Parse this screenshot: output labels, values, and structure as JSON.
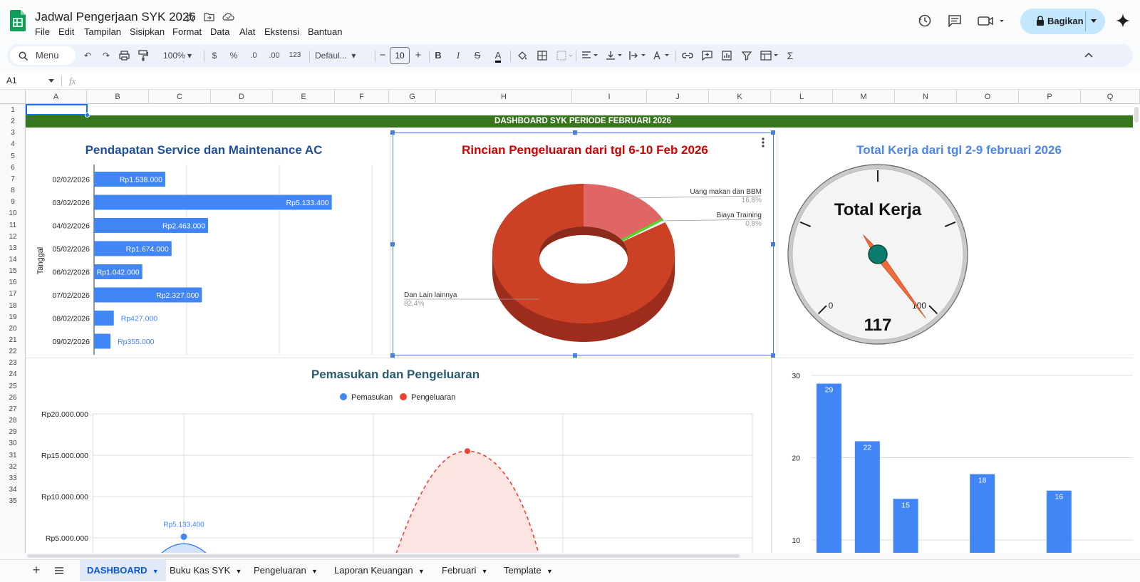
{
  "app": {
    "doc_title": "Jadwal Pengerjaan SYK 2026",
    "menu": [
      "File",
      "Edit",
      "Tampilan",
      "Sisipkan",
      "Format",
      "Data",
      "Alat",
      "Ekstensi",
      "Bantuan"
    ],
    "share_label": "Bagikan",
    "brand_color": "#0f9d58"
  },
  "toolbar": {
    "search_label": "Menu",
    "zoom": "100%",
    "currency": "$",
    "percent": "%",
    "dec_decrease": ".0",
    "dec_increase": ".00",
    "number_format": "123",
    "font": "Defaul...",
    "font_size": "10",
    "bold": "B",
    "italic": "I",
    "strike": "S",
    "text_color": "A"
  },
  "formula_bar": {
    "cell_ref": "A1",
    "fx": "fx",
    "value": ""
  },
  "columns": [
    "A",
    "B",
    "C",
    "D",
    "E",
    "F",
    "G",
    "H",
    "I",
    "J",
    "K",
    "L",
    "M",
    "N",
    "O",
    "P",
    "Q"
  ],
  "rows": [
    "1",
    "2",
    "3",
    "4",
    "5",
    "6",
    "7",
    "8",
    "9",
    "10",
    "11",
    "12",
    "13",
    "14",
    "15",
    "16",
    "17",
    "18",
    "19",
    "20",
    "21",
    "22",
    "23",
    "24",
    "25",
    "26",
    "27",
    "28",
    "29",
    "30",
    "31",
    "32",
    "33",
    "34",
    "35"
  ],
  "banner": {
    "text": "DASHBOARD SYK PERIODE FEBRUARI 2026",
    "color": "#38761d"
  },
  "chart_data": [
    {
      "type": "bar",
      "orientation": "horizontal",
      "title": "Pendapatan Service dan Maintenance AC",
      "ylabel": "Tanggal",
      "categories": [
        "02/02/2026",
        "03/02/2026",
        "04/02/2026",
        "05/02/2026",
        "06/02/2026",
        "07/02/2026",
        "08/02/2026",
        "09/02/2026"
      ],
      "values": [
        1538000,
        5133400,
        2463000,
        1674000,
        1042000,
        2327000,
        427000,
        355000
      ],
      "data_labels": [
        "Rp1.538.000",
        "Rp5.133.400",
        "Rp2.463.000",
        "Rp1.674.000",
        "Rp1.042.000",
        "Rp2.327.000",
        "Rp427.000",
        "Rp355.000"
      ],
      "color": "#4285f4"
    },
    {
      "type": "pie",
      "style": "3d-donut",
      "title": "Rincian Pengeluaran dari tgl 6-10 Feb 2026",
      "slices": [
        {
          "label": "Uang makan dan BBM",
          "pct_label": "16,8%",
          "value": 16.8,
          "color": "#e06666"
        },
        {
          "label": "Biaya Training",
          "pct_label": "0,8%",
          "value": 0.8,
          "color": "#54d42a"
        },
        {
          "label": "Dan Lain lainnya",
          "pct_label": "82,4%",
          "value": 82.4,
          "color": "#cc4125"
        }
      ]
    },
    {
      "type": "gauge",
      "title": "Total Kerja dari tgl 2-9 februari 2026",
      "gauge_label": "Total Kerja",
      "value": 117,
      "value_label": "117",
      "min_label": "0",
      "max_label": "100",
      "min": 0,
      "max": 100
    },
    {
      "type": "area",
      "title": "Pemasukan dan Pengeluaran",
      "series": [
        {
          "name": "Pemasukan",
          "color": "#4285f4",
          "peak": 5133400,
          "peak_label": "Rp5.133.400"
        },
        {
          "name": "Pengeluaran",
          "color": "#ea4335",
          "peak": 15500000
        }
      ],
      "ytick_labels": [
        "Rp20.000.000",
        "Rp15.000.000",
        "Rp10.000.000",
        "Rp5.000.000"
      ],
      "yticks": [
        20000000,
        15000000,
        10000000,
        5000000
      ]
    },
    {
      "type": "bar",
      "ytick_labels": [
        "30",
        "20",
        "10"
      ],
      "yticks": [
        30,
        20,
        10
      ],
      "values": [
        29,
        22,
        15,
        null,
        18,
        null,
        16
      ],
      "data_labels": [
        "29",
        "22",
        "15",
        "18",
        "16"
      ],
      "color": "#4285f4"
    }
  ],
  "sheet_tabs": [
    {
      "label": "DASHBOARD",
      "active": true
    },
    {
      "label": "Buku Kas SYK",
      "active": false
    },
    {
      "label": "Pengeluaran",
      "active": false
    },
    {
      "label": "Laporan Keuangan",
      "active": false
    },
    {
      "label": "Februari",
      "active": false
    },
    {
      "label": "Template",
      "active": false
    }
  ]
}
